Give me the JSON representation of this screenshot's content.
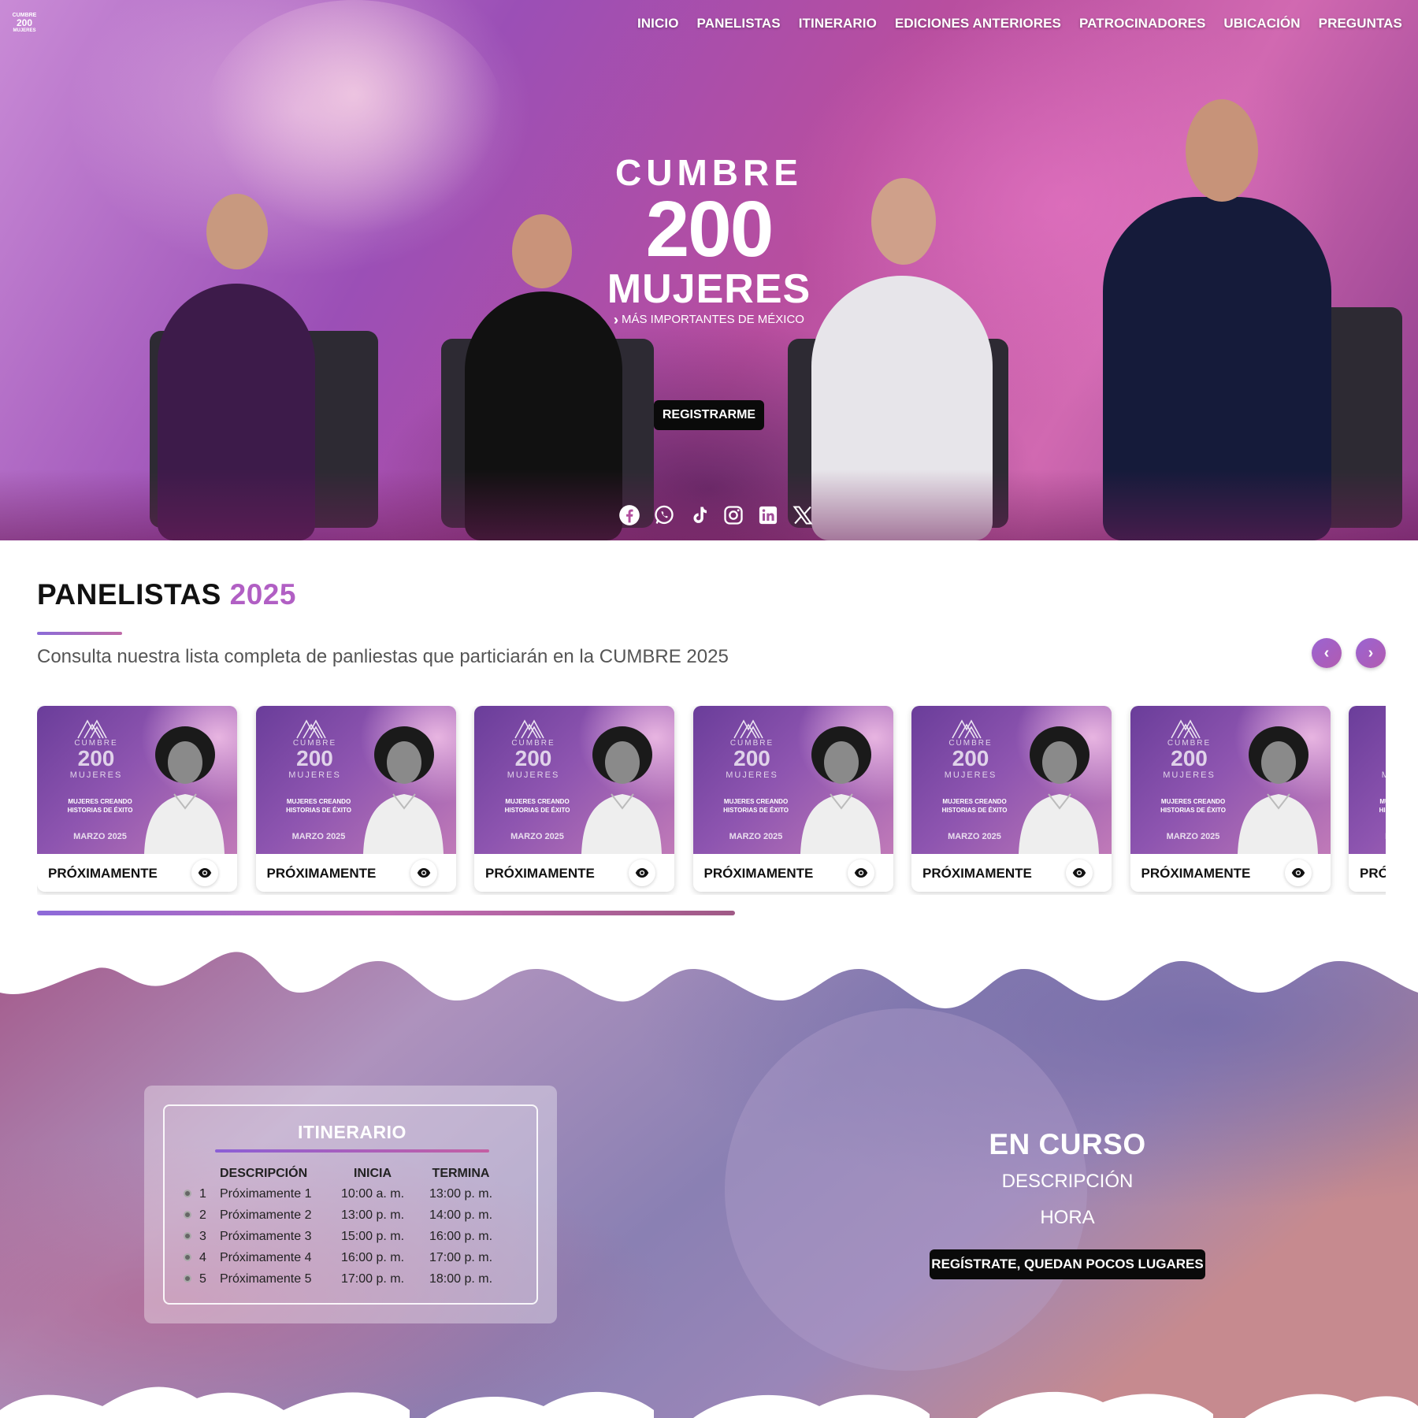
{
  "nav": {
    "items": [
      "INICIO",
      "PANELISTAS",
      "ITINERARIO",
      "EDICIONES ANTERIORES",
      "PATROCINADORES",
      "UBICACIÓN",
      "PREGUNTAS"
    ]
  },
  "hero": {
    "logo_line1": "CUMBRE",
    "logo_line2": "200",
    "logo_line3": "MUJERES",
    "logo_tagline": "MÁS IMPORTANTES DE MÉXICO",
    "register_button": "REGISTRARME",
    "social_icons": [
      "facebook-icon",
      "whatsapp-icon",
      "tiktok-icon",
      "instagram-icon",
      "linkedin-icon",
      "x-icon"
    ]
  },
  "panelistas": {
    "title": "PANELISTAS",
    "year": "2025",
    "subtitle": "Consulta nuestra lista completa de panliestas que particiarán en la CUMBRE 2025",
    "prev_arrow": "‹",
    "next_arrow": "›",
    "cards": [
      {
        "label": "PRÓXIMAMENTE"
      },
      {
        "label": "PRÓXIMAMENTE"
      },
      {
        "label": "PRÓXIMAMENTE"
      },
      {
        "label": "PRÓXIMAMENTE"
      },
      {
        "label": "PRÓXIMAMENTE"
      },
      {
        "label": "PRÓXIMAMENTE"
      },
      {
        "label": "PRÓXIMAMENTE"
      }
    ],
    "card_image": {
      "brand_top": "CUMBRE",
      "brand_num": "200",
      "brand_bottom": "MUJERES",
      "tag_line1": "MUJERES CREANDO",
      "tag_line2": "HISTORIAS DE ÉXITO",
      "date": "MARZO 2025"
    }
  },
  "itinerario": {
    "title": "ITINERARIO",
    "headers": {
      "desc": "DESCRIPCIÓN",
      "inicia": "INICIA",
      "termina": "TERMINA"
    },
    "rows": [
      {
        "num": "1",
        "desc": "Próximamente 1",
        "inicia": "10:00 a. m.",
        "termina": "13:00 p. m."
      },
      {
        "num": "2",
        "desc": "Próximamente 2",
        "inicia": "13:00 p. m.",
        "termina": "14:00 p. m."
      },
      {
        "num": "3",
        "desc": "Próximamente 3",
        "inicia": "15:00 p. m.",
        "termina": "16:00 p. m."
      },
      {
        "num": "4",
        "desc": "Próximamente 4",
        "inicia": "16:00 p. m.",
        "termina": "17:00 p. m."
      },
      {
        "num": "5",
        "desc": "Próximamente 5",
        "inicia": "17:00 p. m.",
        "termina": "18:00 p. m."
      }
    ]
  },
  "en_curso": {
    "title": "EN CURSO",
    "descripcion": "DESCRIPCIÓN",
    "hora": "HORA",
    "cta": "REGÍSTRATE, QUEDAN POCOS LUGARES"
  },
  "colors": {
    "accent": "#b15fc4",
    "button_dark": "#0a0a0a"
  }
}
